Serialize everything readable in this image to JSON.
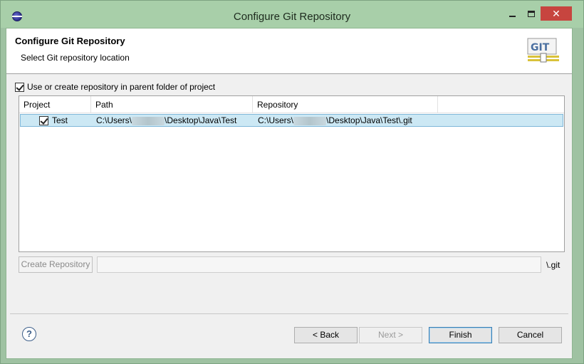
{
  "window": {
    "title": "Configure Git Repository",
    "close_glyph": "✕"
  },
  "banner": {
    "title": "Configure Git Repository",
    "message": "Select Git repository location",
    "logo_text": "GIT"
  },
  "options": {
    "use_parent_label": "Use or create repository in parent folder of project",
    "use_parent_checked": true
  },
  "table": {
    "columns": [
      "Project",
      "Path",
      "Repository"
    ],
    "rows": [
      {
        "checked": true,
        "project": "Test",
        "path_prefix": "C:\\Users\\",
        "path_suffix": "\\Desktop\\Java\\Test",
        "repo_prefix": "C:\\Users\\",
        "repo_suffix": "\\Desktop\\Java\\Test\\.git"
      }
    ]
  },
  "create": {
    "button_label": "Create Repository",
    "input_value": "",
    "suffix": "\\.git"
  },
  "footer": {
    "help_glyph": "?",
    "back_label": "< Back",
    "next_label": "Next >",
    "finish_label": "Finish",
    "cancel_label": "Cancel"
  },
  "colors": {
    "selection": "#cce8f4",
    "titlebar": "#a8cfa9",
    "close": "#c7453f"
  }
}
